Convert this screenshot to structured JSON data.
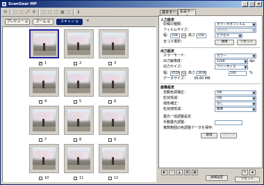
{
  "window": {
    "title": "ScanGear MP",
    "minimize": "_",
    "maximize": "□",
    "close": "×"
  },
  "toolbar": {
    "icons": [
      "↻",
      "⬚",
      "⬚",
      "⤢",
      "⚲",
      "⬚",
      "⬚",
      "⬚",
      "▤",
      "⬚",
      "⬚",
      "ℹ"
    ]
  },
  "modes": {
    "preview": "プレビュー",
    "zoom": "ズーム",
    "scan": "スキャン",
    "close": "✕"
  },
  "thumbs": [
    {
      "num": "1",
      "checked": true
    },
    {
      "num": "2",
      "checked": false
    },
    {
      "num": "3",
      "checked": false
    },
    {
      "num": "4",
      "checked": false
    },
    {
      "num": "5",
      "checked": false
    },
    {
      "num": "6",
      "checked": false
    },
    {
      "num": "7",
      "checked": false
    },
    {
      "num": "8",
      "checked": false
    },
    {
      "num": "9",
      "checked": false
    },
    {
      "num": "10",
      "checked": false
    },
    {
      "num": "11",
      "checked": false
    },
    {
      "num": "12",
      "checked": false
    }
  ],
  "tabs": {
    "basic": "基本モード",
    "advanced": "拡張モード"
  },
  "input": {
    "heading": "入力設定",
    "doc_type_label": "原稿の種類：",
    "doc_type_value": "カラーネガフィルム",
    "film_size_label": "フィルムサイズ：",
    "film_size_value": "35mm",
    "width_label": "幅：",
    "width_value": "238",
    "height_label": "高さ：",
    "height_value": "158",
    "unit_value": "ピクセル",
    "select_all_label": "全コマ選択：",
    "apply": "適用",
    "reset": "リセット"
  },
  "output": {
    "heading": "出力設定",
    "color_mode_label": "カラーモード：",
    "color_mode_value": "カラー",
    "resolution_label": "出力解像度：",
    "resolution_value": "1200",
    "resolution_unit": "dpi",
    "size_label": "出力サイズ：",
    "size_value": "フリーサイズ",
    "out_width": "4559",
    "out_height": "3036",
    "percent": "100",
    "percent_unit": "%",
    "data_size_label": "データサイズ：",
    "data_size_value": "39.60 MB"
  },
  "image": {
    "heading": "画像設定",
    "rows": [
      {
        "label": "自動色調補正：",
        "value": "ON"
      },
      {
        "label": "粒状低減：",
        "value": "ON"
      },
      {
        "label": "褪色補正：",
        "value": "なし"
      },
      {
        "label": "粒状感低減：",
        "value": "標準"
      }
    ],
    "text1": "露光一括調整設定",
    "text2": "手動露光調整：",
    "text3": "複数範囲の色調整データを保存：",
    "get": "取得",
    "cancel": "リセット"
  },
  "bottom": {
    "reset": "リセット",
    "prefs": "詳細設定"
  }
}
